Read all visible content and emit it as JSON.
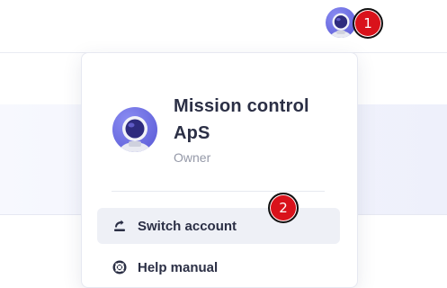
{
  "header": {
    "avatar_icon": "astronaut-avatar-icon"
  },
  "account_menu": {
    "account_name": "Mission control ApS",
    "role": "Owner",
    "avatar_icon": "astronaut-avatar-icon",
    "items": [
      {
        "label": "Switch account",
        "icon": "switch-account-icon",
        "active": true
      },
      {
        "label": "Help manual",
        "icon": "lifebuoy-icon",
        "active": false
      }
    ]
  },
  "markers": [
    {
      "label": "1"
    },
    {
      "label": "2"
    }
  ],
  "colors": {
    "marker": "#d9121b",
    "text_primary": "#2b2f45",
    "text_secondary": "#9599a8",
    "hover_bg": "#eef0f6",
    "avatar_purple": "#6f6fe3"
  }
}
